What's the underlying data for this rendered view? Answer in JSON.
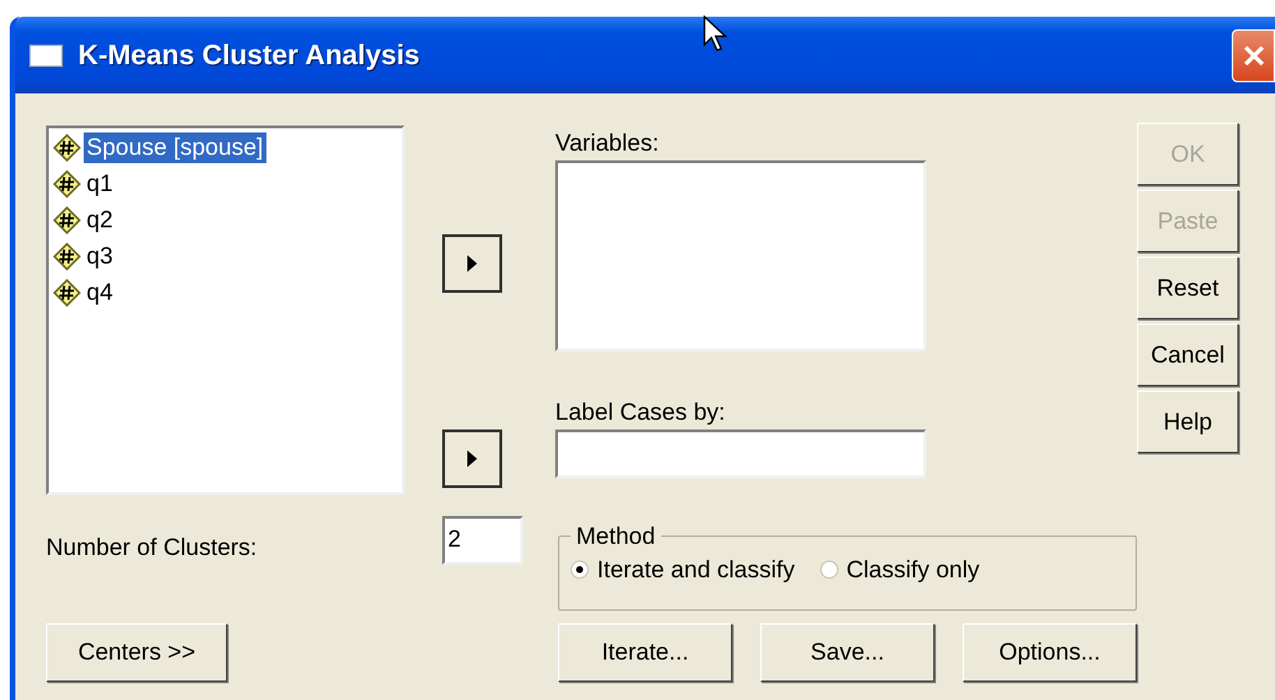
{
  "window": {
    "title": "K-Means Cluster Analysis"
  },
  "source_variables": [
    {
      "label": "Spouse [spouse]",
      "selected": true
    },
    {
      "label": "q1",
      "selected": false
    },
    {
      "label": "q2",
      "selected": false
    },
    {
      "label": "q3",
      "selected": false
    },
    {
      "label": "q4",
      "selected": false
    }
  ],
  "variables": {
    "label": "Variables:"
  },
  "label_cases_by": {
    "label": "Label Cases by:"
  },
  "side_buttons": [
    {
      "label": "OK",
      "disabled": true
    },
    {
      "label": "Paste",
      "disabled": true
    },
    {
      "label": "Reset",
      "disabled": false
    },
    {
      "label": "Cancel",
      "disabled": false
    },
    {
      "label": "Help",
      "disabled": false
    }
  ],
  "number_of_clusters": {
    "label": "Number of Clusters:",
    "value": "2"
  },
  "method": {
    "title": "Method",
    "options": [
      {
        "label": "Iterate and classify",
        "selected": true
      },
      {
        "label": "Classify only",
        "selected": false
      }
    ]
  },
  "bottom_buttons": [
    "Centers >>",
    "Iterate...",
    "Save...",
    "Options..."
  ]
}
